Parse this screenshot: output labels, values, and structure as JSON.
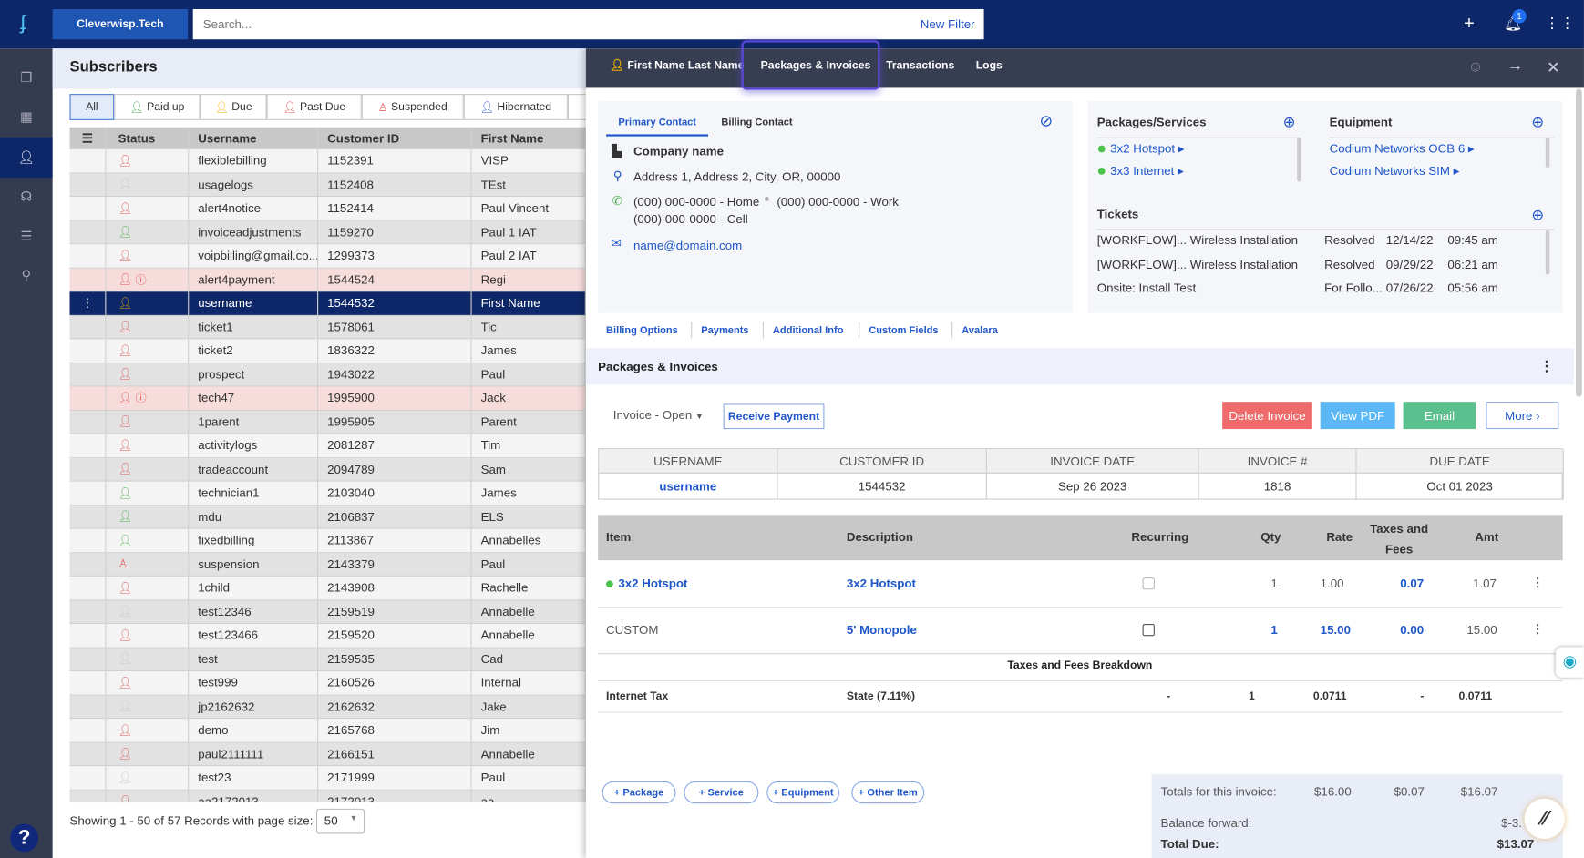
{
  "topbar": {
    "brand": "Cleverwisp.Tech",
    "search_placeholder": "Search...",
    "new_filter": "New Filter",
    "notification_count": "1"
  },
  "sidebar": {
    "items": [
      "copy-icon",
      "dashboard-icon",
      "user-icon",
      "support-icon",
      "list-icon",
      "location-icon"
    ],
    "active": "user-icon",
    "help": "?"
  },
  "subscribers": {
    "title": "Subscribers",
    "filters": [
      {
        "label": "All",
        "color": ""
      },
      {
        "label": "Paid up",
        "color": "#4cae4c"
      },
      {
        "label": "Due",
        "color": "#f0b400"
      },
      {
        "label": "Past Due",
        "color": "#e05252"
      },
      {
        "label": "Suspended",
        "color": "#e05252"
      },
      {
        "label": "Hibernated",
        "color": "#1f56c8"
      }
    ],
    "columns": [
      "Status",
      "Username",
      "Customer ID",
      "First Name"
    ],
    "rows": [
      {
        "status": "red",
        "username": "flexiblebilling",
        "id": "1152391",
        "first": "VISP"
      },
      {
        "status": "grey",
        "username": "usagelogs",
        "id": "1152408",
        "first": "TEst"
      },
      {
        "status": "red",
        "username": "alert4notice",
        "id": "1152414",
        "first": "Paul Vincent"
      },
      {
        "status": "green",
        "username": "invoiceadjustments",
        "id": "1159270",
        "first": "Paul 1 IAT"
      },
      {
        "status": "red",
        "username": "voipbilling@gmail.co...",
        "id": "1299373",
        "first": "Paul 2 IAT"
      },
      {
        "status": "red-alert",
        "username": "alert4payment",
        "id": "1544524",
        "first": "Regi"
      },
      {
        "status": "selected",
        "username": "username",
        "id": "1544532",
        "first": "First Name"
      },
      {
        "status": "red",
        "username": "ticket1",
        "id": "1578061",
        "first": "Tic"
      },
      {
        "status": "red",
        "username": "ticket2",
        "id": "1836322",
        "first": "James"
      },
      {
        "status": "red",
        "username": "prospect",
        "id": "1943022",
        "first": "Paul"
      },
      {
        "status": "red-alert",
        "username": "tech47",
        "id": "1995900",
        "first": "Jack"
      },
      {
        "status": "red",
        "username": "1parent",
        "id": "1995905",
        "first": "Parent"
      },
      {
        "status": "red",
        "username": "activitylogs",
        "id": "2081287",
        "first": "Tim"
      },
      {
        "status": "red",
        "username": "tradeaccount",
        "id": "2094789",
        "first": "Sam"
      },
      {
        "status": "green",
        "username": "technician1",
        "id": "2103040",
        "first": "James"
      },
      {
        "status": "green",
        "username": "mdu",
        "id": "2106837",
        "first": "ELS"
      },
      {
        "status": "green",
        "username": "fixedbilling",
        "id": "2113867",
        "first": "Annabelles"
      },
      {
        "status": "suspended",
        "username": "suspension",
        "id": "2143379",
        "first": "Paul"
      },
      {
        "status": "red",
        "username": "1child",
        "id": "2143908",
        "first": "Rachelle"
      },
      {
        "status": "grey",
        "username": "test12346",
        "id": "2159519",
        "first": "Annabelle"
      },
      {
        "status": "red",
        "username": "test123466",
        "id": "2159520",
        "first": "Annabelle"
      },
      {
        "status": "grey",
        "username": "test",
        "id": "2159535",
        "first": "Cad"
      },
      {
        "status": "red",
        "username": "test999",
        "id": "2160526",
        "first": "Internal"
      },
      {
        "status": "grey",
        "username": "jp2162632",
        "id": "2162632",
        "first": "Jake"
      },
      {
        "status": "red",
        "username": "demo",
        "id": "2165768",
        "first": "Jim"
      },
      {
        "status": "red",
        "username": "paul2111111",
        "id": "2166151",
        "first": "Annabelle"
      },
      {
        "status": "grey",
        "username": "test23",
        "id": "2171999",
        "first": "Paul"
      },
      {
        "status": "red",
        "username": "aa2172013",
        "id": "2172013",
        "first": "aa"
      }
    ],
    "footer": "Showing 1 - 50 of 57 Records with page size:",
    "page_size": "50"
  },
  "detail": {
    "tabs": [
      "First Name Last Name",
      "Packages & Invoices",
      "Transactions",
      "Logs"
    ],
    "active_tab": "First Name Last Name",
    "highlighted_tab": "Packages & Invoices",
    "contact_tabs": [
      "Primary Contact",
      "Billing Contact"
    ],
    "company": "Company name",
    "address": "Address 1, Address 2, City, OR, 00000",
    "phone_home": "(000) 000-0000 - Home",
    "phone_work": "(000) 000-0000 - Work",
    "phone_cell": "(000) 000-0000 - Cell",
    "email": "name@domain.com",
    "packages_title": "Packages/Services",
    "packages": [
      "3x2 Hotspot",
      "3x3 Internet"
    ],
    "equipment_title": "Equipment",
    "equipment": [
      "Codium Networks OCB 6",
      "Codium Networks SIM"
    ],
    "tickets_title": "Tickets",
    "tickets": [
      {
        "title": "[WORKFLOW]... Wireless Installation",
        "status": "Resolved",
        "date": "12/14/22",
        "time": "09:45 am"
      },
      {
        "title": "[WORKFLOW]... Wireless Installation",
        "status": "Resolved",
        "date": "09/29/22",
        "time": "06:21 am"
      },
      {
        "title": "Onsite: Install   Test",
        "status": "For Follo...",
        "date": "07/26/22",
        "time": "05:56 am"
      }
    ],
    "subtabs": [
      "Billing Options",
      "Payments",
      "Additional Info",
      "Custom Fields",
      "Avalara"
    ]
  },
  "invoice": {
    "section_title": "Packages & Invoices",
    "status_select": "Invoice - Open",
    "receive_payment": "Receive Payment",
    "delete": "Delete Invoice",
    "view_pdf": "View PDF",
    "email": "Email",
    "more": "More",
    "info_headers": [
      "USERNAME",
      "CUSTOMER ID",
      "INVOICE DATE",
      "INVOICE #",
      "DUE DATE"
    ],
    "info_values": [
      "username",
      "1544532",
      "Sep 26 2023",
      "1818",
      "Oct 01 2023"
    ],
    "item_headers": [
      "Item",
      "Description",
      "Recurring",
      "Qty",
      "Rate",
      "Taxes and Fees",
      "Amt"
    ],
    "items": [
      {
        "item": "3x2 Hotspot",
        "description": "3x2 Hotspot",
        "qty": "1",
        "rate": "1.00",
        "taxes": "0.07",
        "amt": "1.07"
      },
      {
        "item": "CUSTOM",
        "description": "5' Monopole",
        "qty": "1",
        "rate": "15.00",
        "taxes": "0.00",
        "amt": "15.00"
      }
    ],
    "breakdown_title": "Taxes and Fees Breakdown",
    "breakdown": {
      "name": "Internet Tax",
      "desc": "State (7.11%)",
      "recurring": "-",
      "qty": "1",
      "rate": "0.0711",
      "taxes": "-",
      "amt": "0.0711"
    },
    "add_buttons": [
      "+ Package",
      "+ Service",
      "+ Equipment",
      "+ Other Item"
    ],
    "totals_label": "Totals for this invoice:",
    "totals": [
      "$16.00",
      "$0.07",
      "$16.07"
    ],
    "balance_label": "Balance forward:",
    "balance": "$-3.",
    "total_due_label": "Total Due:",
    "total_due": "$13.07"
  },
  "colors": {
    "navy": "#0d2768",
    "red": "#e05252",
    "green": "#4cae4c",
    "grey": "#c8c8c8",
    "yellow": "#f0b400",
    "delete": "#ef6b6b",
    "pdf": "#5bb8f5",
    "email": "#5cbf8e"
  }
}
